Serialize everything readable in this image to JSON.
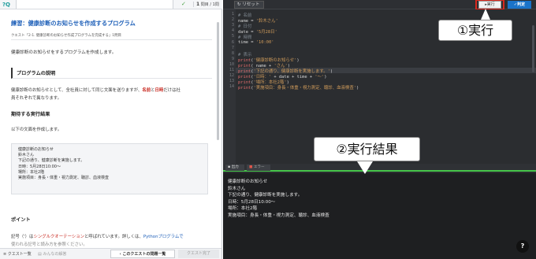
{
  "topbar": {
    "progress_count": "1",
    "progress_total": "問目 / 1問"
  },
  "lesson": {
    "title": "練習：健康診断のお知らせを作成するプログラム",
    "subtitle": "クエスト「2-1. 健康診断のお知らせ作成プログラムを完成する」1問目",
    "intro": "健康診断のお知らせをするプログラムを作成します。",
    "section1_heading": "プログラムの説明",
    "section1_text_a": "健康診断のお知らせとして、全社員に対して同じ文面を送りますが、",
    "section1_red1": "名前",
    "section1_and": "と",
    "section1_red2": "日時",
    "section1_text_b": "だけは社",
    "section1_text_c": "員それぞれで異なります。",
    "section2_heading": "期待する実行結果",
    "section2_text": "以下の文面を作成します。",
    "sample_lines": [
      "健康診断のお知らせ",
      "鈴木さん",
      "下記の通り、健康診断を実施します。",
      "日時：5月28日10:00～",
      "場所：本社2階",
      "実施項目：身長・体重・視力測定、聴診、血液検査"
    ],
    "section3_heading": "ポイント",
    "point_prefix": "記号（'）は",
    "point_red": "シングルクオーテーション",
    "point_mid": "と呼ばれています。詳しくは、",
    "point_link": "Pythonプログラムで",
    "point_next": "使われる記号と読み方を参照ください。"
  },
  "footer": {
    "quest_list": "クエスト一覧",
    "answers": "みんなの解答",
    "quest_problems": "このクエストの問題一覧",
    "quest_done": "クエスト完了"
  },
  "editor": {
    "reset_label": "リセット",
    "run_label": "実行",
    "submit_label": "判定",
    "lines": [
      {
        "n": "1",
        "html": "<span class='c'># 名前</span>"
      },
      {
        "n": "2",
        "html": "name = <span class='s'>'鈴木さん'</span>"
      },
      {
        "n": "3",
        "html": "<span class='c'># 日付</span>"
      },
      {
        "n": "4",
        "html": "date = <span class='s'>'5月28日'</span>"
      },
      {
        "n": "5",
        "html": "<span class='c'># 時間</span>"
      },
      {
        "n": "6",
        "html": "time = <span class='s'>'10:00'</span>"
      },
      {
        "n": "7",
        "html": ""
      },
      {
        "n": "8",
        "html": "<span class='c'># 表示</span>"
      },
      {
        "n": "9",
        "html": "<span class='f'>print</span>(<span class='s'>'健康診断のお知らせ'</span>)"
      },
      {
        "n": "10",
        "html": "<span class='f'>print</span>( name + <span class='s'>'さん'</span>)"
      },
      {
        "n": "11",
        "html": "<span class='f'>print</span>(<span class='s'>'下記の通り、健康診断を実施します。'</span>)"
      },
      {
        "n": "12",
        "html": "<span class='f'>print</span>(<span class='s'>'日時：'</span> + date + time + <span class='s'>'～'</span>)"
      },
      {
        "n": "13",
        "html": "<span class='f'>print</span>(<span class='s'>'場所：本社2階'</span>)"
      },
      {
        "n": "14",
        "html": "<span class='f'>print</span>(<span class='s'>'実施項目：身長・体重・視力測定、聴診、血液検査'</span>)"
      }
    ]
  },
  "tabs": {
    "output_tab": "出力",
    "error_tab": "エラー"
  },
  "console": {
    "lines": [
      "健康診断のお知らせ",
      "鈴木さん",
      "下記の通り、健康診断を実施します。",
      "日時：5月28日10:00～",
      "場所：本社2階",
      "実施項目：身長・体重・視力測定、聴診、血液検査"
    ]
  },
  "callouts": {
    "run": "①実行",
    "result": "②実行結果"
  },
  "help_label": "?"
}
